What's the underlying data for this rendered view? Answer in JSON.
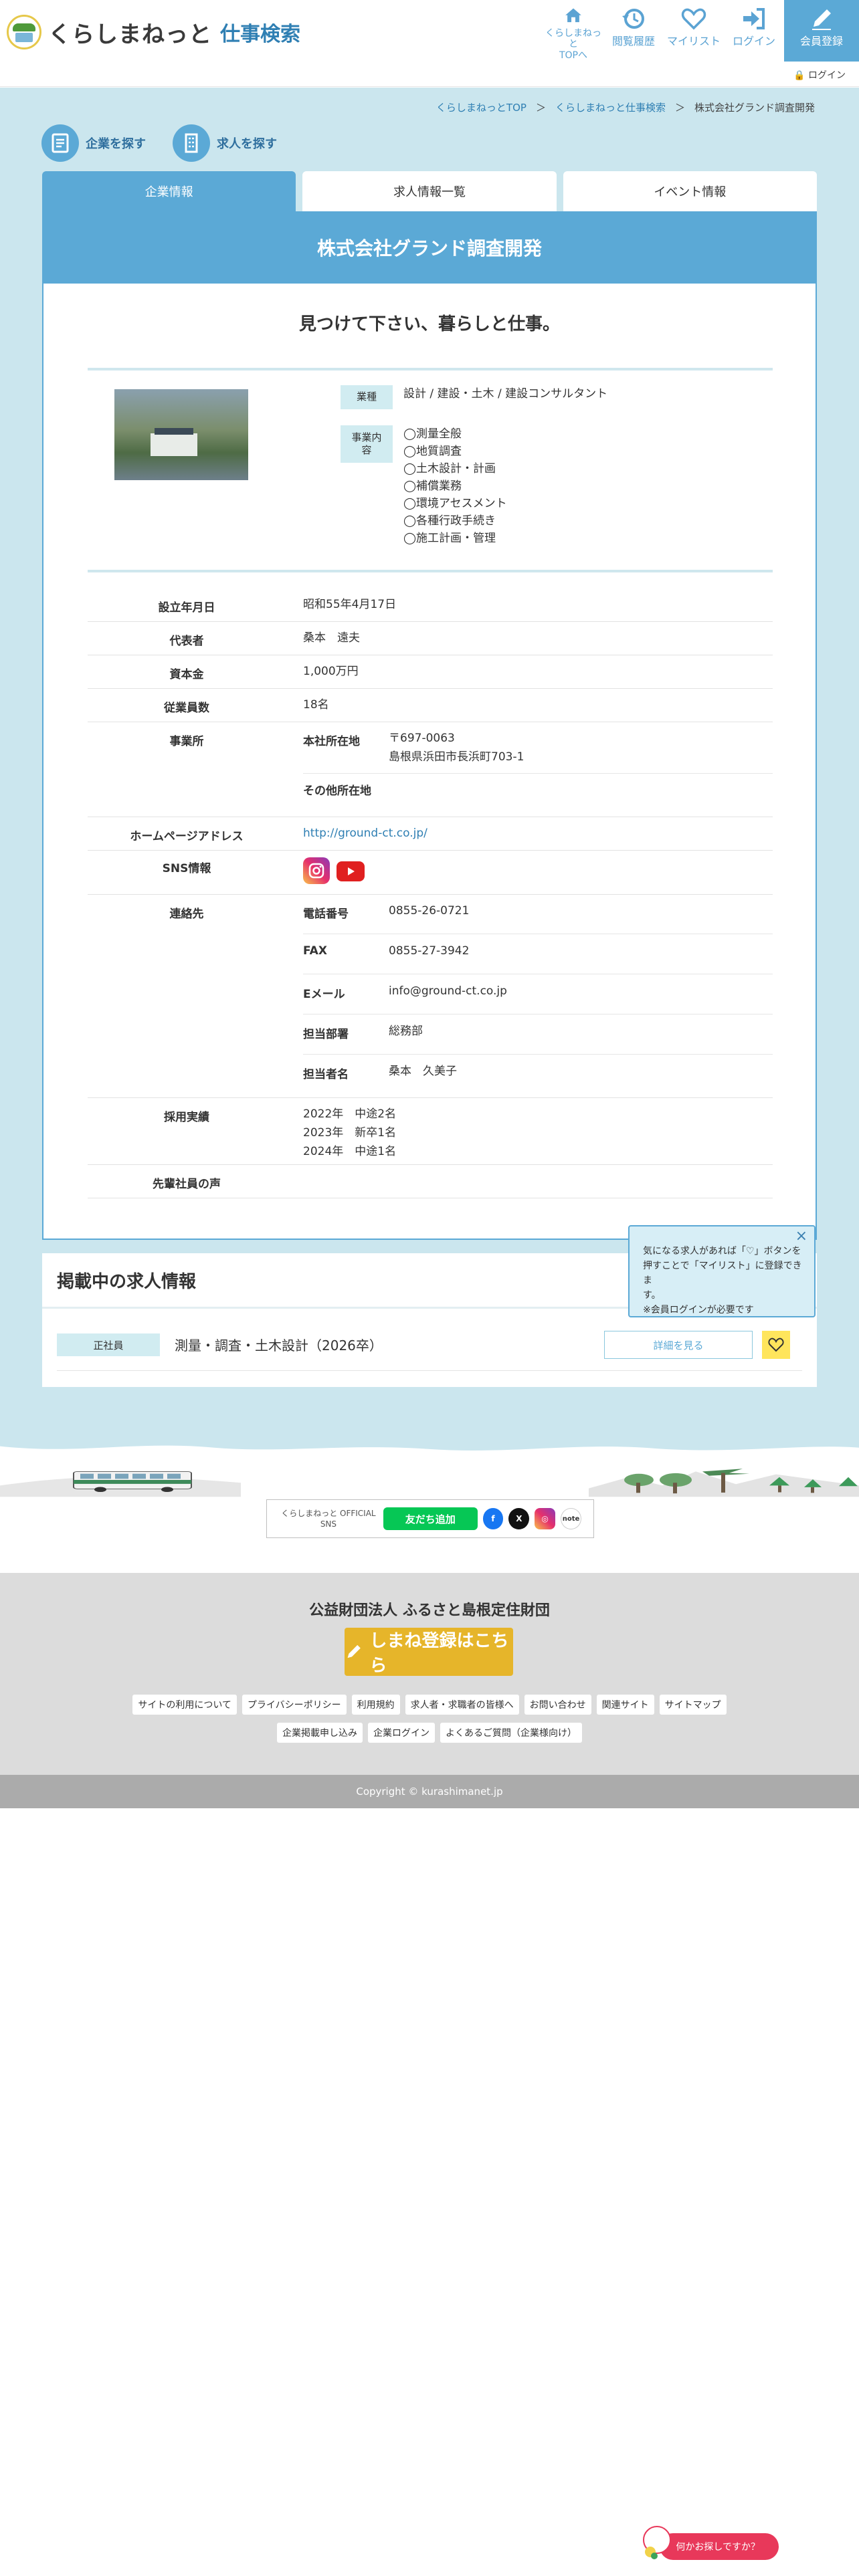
{
  "header": {
    "logo_text": "くらしまねっと",
    "logo_sub": "仕事検索",
    "nav": [
      {
        "label": "くらしまねっと\nTOPへ",
        "icon": "home-icon"
      },
      {
        "label": "閲覧履歴",
        "icon": "history-icon"
      },
      {
        "label": "マイリスト",
        "icon": "heart-icon"
      },
      {
        "label": "ログイン",
        "icon": "login-icon"
      },
      {
        "label": "会員登録",
        "icon": "pencil-icon"
      }
    ],
    "mini_login": "🔒 ログイン"
  },
  "breadcrumb": {
    "items": [
      "くらしまねっとTOP",
      "＞",
      "くらしまねっと仕事検索",
      "＞",
      "株式会社グランド調査開発"
    ]
  },
  "search_links": {
    "company": "企業を探す",
    "job": "求人を探す"
  },
  "tabs": [
    "企業情報",
    "求人情報一覧",
    "イベント情報"
  ],
  "company": {
    "name": "株式会社グランド調査開発",
    "catchphrase": "見つけて下さい、暮らしと仕事。",
    "industry_label": "業種",
    "industry": "設計 / 建設・土木 / 建設コンサルタント",
    "business_label": "事業内容",
    "business": [
      "◯測量全般",
      "◯地質調査",
      "◯土木設計・計画",
      "◯補償業務",
      "◯環境アセスメント",
      "◯各種行政手続き",
      "◯施工計画・管理"
    ],
    "rows": {
      "founded_label": "設立年月日",
      "founded": "昭和55年4月17日",
      "rep_label": "代表者",
      "rep": "桑本　遠夫",
      "capital_label": "資本金",
      "capital": "1,000万円",
      "employees_label": "従業員数",
      "employees": "18名",
      "office_label": "事業所",
      "hq_label": "本社所在地",
      "hq_zip": "〒697-0063",
      "hq_addr": "島根県浜田市長浜町703-1",
      "other_label": "その他所在地",
      "hp_label": "ホームページアドレス",
      "hp": "http://ground-ct.co.jp/",
      "sns_label": "SNS情報",
      "contact_label": "連絡先",
      "tel_label": "電話番号",
      "tel": "0855-26-0721",
      "fax_label": "FAX",
      "fax": "0855-27-3942",
      "email_label": "Eメール",
      "email": "info@ground-ct.co.jp",
      "dept_label": "担当部署",
      "dept": "総務部",
      "person_label": "担当者名",
      "person": "桑本　久美子",
      "hiring_label": "採用実績",
      "hiring": [
        "2022年　中途2名",
        "2023年　新卒1名",
        "2024年　中途1名"
      ],
      "voice_label": "先輩社員の声"
    }
  },
  "jobs": {
    "title": "掲載中の求人情報",
    "items": [
      {
        "type": "正社員",
        "name": "測量・調査・土木設計（2026卒）",
        "detail": "詳細を見る"
      }
    ]
  },
  "tooltip": {
    "lines": [
      "気になる求人があれば「♡」ボタンを",
      "押すことで「マイリスト」に登録できま",
      "す。",
      "※会員ログインが必要です"
    ]
  },
  "footer": {
    "sns_label": "くらしまねっと OFFICIAL SNS",
    "line_button": "友だち追加",
    "note": "note",
    "foundation": "公益財団法人 ふるさと島根定住財団",
    "register_button": "しまね登録はこちら",
    "links_row1": [
      "サイトの利用について",
      "プライバシーポリシー",
      "利用規約",
      "求人者・求職者の皆様へ",
      "お問い合わせ",
      "関連サイト",
      "サイトマップ"
    ],
    "links_row2": [
      "企業掲載申し込み",
      "企業ログイン",
      "よくあるご質問（企業様向け）"
    ],
    "copyright": "Copyright © kurashimanet.jp"
  },
  "help_button": "何かお探しですか？",
  "colors": {
    "accent": "#5ba9d6",
    "page_bg": "#cbe6ee",
    "tag_bg": "#d1ecf1",
    "line_green": "#06c755",
    "register_gold": "#e6b52a",
    "help_red": "#e8385a"
  }
}
